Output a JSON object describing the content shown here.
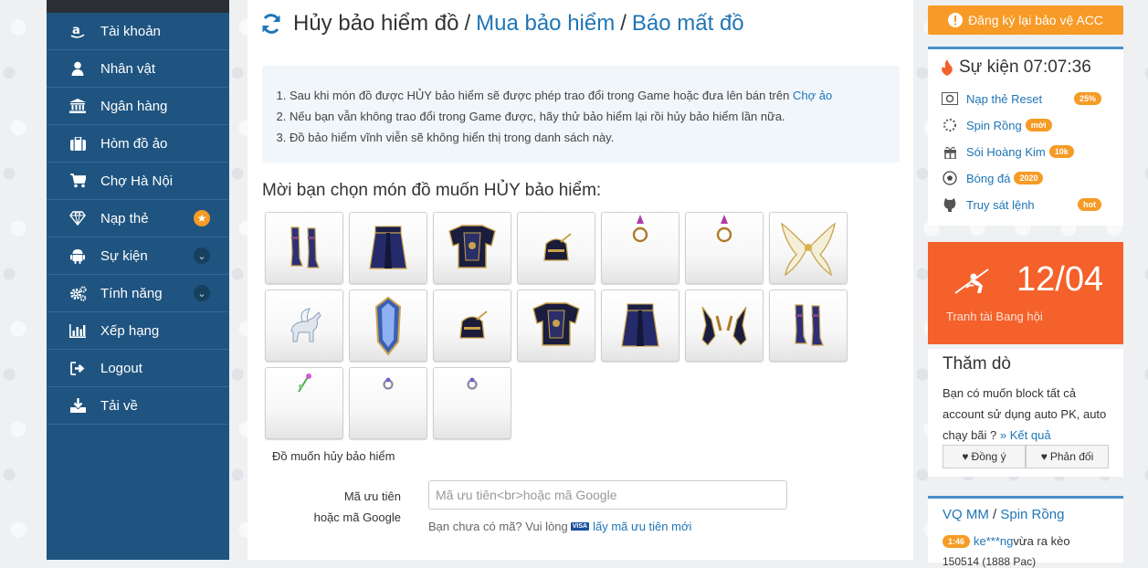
{
  "sidebar": {
    "items": [
      {
        "label": "Tài khoản",
        "icon": "amazon-icon"
      },
      {
        "label": "Nhân vật",
        "icon": "user-icon"
      },
      {
        "label": "Ngân hàng",
        "icon": "bank-icon"
      },
      {
        "label": "Hòm đồ ảo",
        "icon": "suitcase-icon"
      },
      {
        "label": "Chợ Hà Nội",
        "icon": "cart-icon"
      },
      {
        "label": "Nạp thẻ",
        "icon": "diamond-icon"
      },
      {
        "label": "Sự kiện",
        "icon": "android-icon"
      },
      {
        "label": "Tính năng",
        "icon": "cogs-icon"
      },
      {
        "label": "Xếp hạng",
        "icon": "bar-chart-icon"
      },
      {
        "label": "Logout",
        "icon": "sign-out-icon"
      },
      {
        "label": "Tải về",
        "icon": "download-icon"
      }
    ],
    "star_badge": "★",
    "chevron_badge": "⌄"
  },
  "header": {
    "icon": "refresh-icon",
    "title_current": "Hủy bảo hiểm đồ",
    "separator": "/",
    "link1": "Mua bảo hiểm",
    "link2": "Báo mất đồ"
  },
  "notice": {
    "line1_text": "Sau khi món đồ được HỦY bảo hiểm sẽ được phép trao đổi trong Game hoặc đưa lên bán trên ",
    "line1_link": "Chợ ảo",
    "line2": "Nếu bạn vẫn không trao đổi trong Game được, hãy thử bảo hiểm lại rồi hủy bảo hiểm lần nữa.",
    "line3": "Đồ bảo hiểm vĩnh viễn sẽ không hiển thị trong danh sách này."
  },
  "choose_heading": "Mời bạn chọn món đồ muốn HỦY bảo hiểm:",
  "items": [
    {
      "name": "boots-item"
    },
    {
      "name": "skirt-item"
    },
    {
      "name": "armor-item"
    },
    {
      "name": "helmet-item"
    },
    {
      "name": "ring-item"
    },
    {
      "name": "ring-item"
    },
    {
      "name": "wings-item"
    },
    {
      "name": "pegasus-pet-item"
    },
    {
      "name": "shield-item"
    },
    {
      "name": "helmet-item"
    },
    {
      "name": "armor-item"
    },
    {
      "name": "skirt-item"
    },
    {
      "name": "gloves-item"
    },
    {
      "name": "boots-item"
    },
    {
      "name": "flower-item"
    },
    {
      "name": "small-ring-item"
    },
    {
      "name": "small-ring-item"
    }
  ],
  "caption": "Đồ muốn hủy bảo hiểm",
  "form": {
    "label_line1": "Mã ưu tiên",
    "label_line2": "hoặc mã Google",
    "placeholder": "Mã ưu tiên<br>hoặc mã Google",
    "help_text": "Bạn chưa có mã? Vui lòng",
    "help_card": "VISA",
    "help_link": "lấy mã ưu tiên mới"
  },
  "right": {
    "register_button": "Đăng ký lại bảo vệ ACC",
    "events_title": "Sự kiện 07:07:36",
    "events": [
      {
        "label": "Nạp thẻ Reset",
        "badge": "25%",
        "icon": "reset-icon"
      },
      {
        "label": "Spin Rồng",
        "badge": "mới",
        "icon": "spinner-icon"
      },
      {
        "label": "Sói Hoàng Kim",
        "badge": "10k",
        "icon": "gift-icon"
      },
      {
        "label": "Bóng đá",
        "badge": "2020",
        "icon": "soccer-ball-icon"
      },
      {
        "label": "Truy sát lệnh",
        "badge": "hot",
        "icon": "github-icon"
      }
    ],
    "tournament_date": "12/04",
    "tournament_label": "Tranh tài Bang hội",
    "poll_title": "Thăm dò",
    "poll_question": "Bạn có muốn block tất cả account sử dụng auto PK, auto chạy bãi ?",
    "poll_result_link": "Kết quả",
    "poll_agree": "Đồng ý",
    "poll_disagree": "Phản đối",
    "vq_link1": "VQ MM",
    "vq_sep": " / ",
    "vq_link2": "Spin Rồng",
    "vq_badge": "1:46",
    "vq_user": "ke***ng",
    "vq_text": " vừa ra kèo",
    "vq_line2": "150514 (1888 Pac)",
    "colors": {
      "sidebar": "#1f5480",
      "accent": "#f79a26",
      "link": "#1f75b5",
      "tournament": "#f4612a"
    }
  }
}
